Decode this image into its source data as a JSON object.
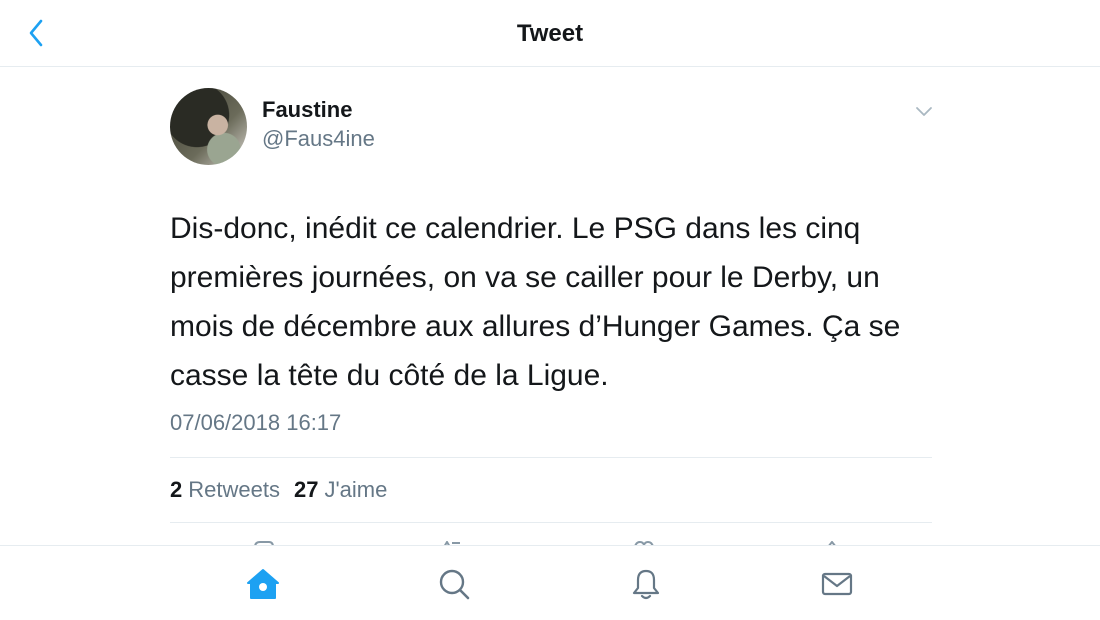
{
  "header": {
    "title": "Tweet",
    "back_icon": "chevron-left-icon"
  },
  "tweet": {
    "author_name": "Faustine",
    "author_handle": "@Faus4ine",
    "text": "Dis-donc, inédit ce calendrier. Le PSG dans les cinq premières journées, on va se cailler pour le Derby, un mois de décembre aux allures d’Hunger Games. Ça se casse la tête du côté de la Ligue.",
    "timestamp": "07/06/2018 16:17",
    "retweets_count": "2",
    "retweets_label": "Retweets",
    "likes_count": "27",
    "likes_label": "J'aime"
  },
  "bottom_nav": {
    "items": [
      {
        "icon": "home-icon",
        "active": true
      },
      {
        "icon": "search-icon",
        "active": false
      },
      {
        "icon": "bell-icon",
        "active": false
      },
      {
        "icon": "mail-icon",
        "active": false
      }
    ]
  },
  "colors": {
    "accent": "#1da1f2",
    "text_primary": "#14171a",
    "text_secondary": "#657786",
    "border": "#e6ecf0"
  }
}
